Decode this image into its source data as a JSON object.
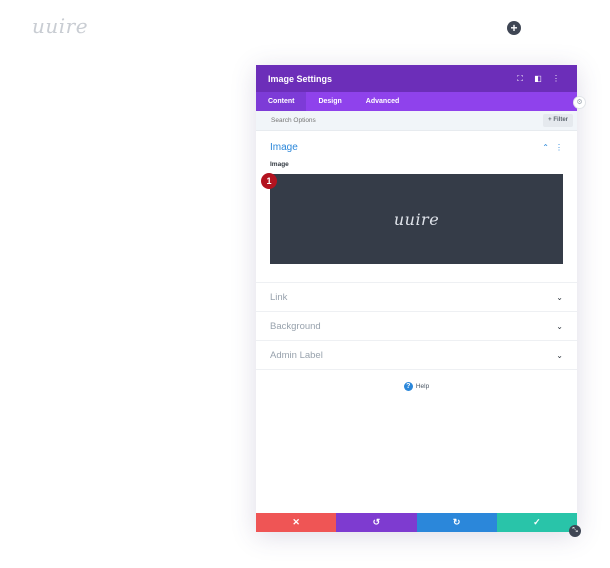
{
  "page": {
    "logo_text": "uuire",
    "add_icon": "plus-icon"
  },
  "modal": {
    "title": "Image Settings",
    "header_icons": [
      "expand-icon",
      "split-view-icon",
      "more-icon"
    ],
    "tabs": [
      {
        "label": "Content",
        "active": true
      },
      {
        "label": "Design",
        "active": false
      },
      {
        "label": "Advanced",
        "active": false
      }
    ],
    "search": {
      "placeholder": "Search Options",
      "filter_label": "+ Filter"
    },
    "image_section": {
      "title": "Image",
      "field_label": "Image",
      "preview_logo_text": "uuire",
      "badge": "1"
    },
    "sections": [
      {
        "title": "Link"
      },
      {
        "title": "Background"
      },
      {
        "title": "Admin Label"
      }
    ],
    "help_label": "Help",
    "footer": {
      "colors": {
        "cancel": "#ef5555",
        "undo": "#7e3bd0",
        "redo": "#2b87da",
        "save": "#29c4a9"
      }
    }
  },
  "colors": {
    "header": "#6c2eb9",
    "tabs": "#8f42ec",
    "accent": "#2b87da",
    "preview_bg": "#353c48"
  }
}
